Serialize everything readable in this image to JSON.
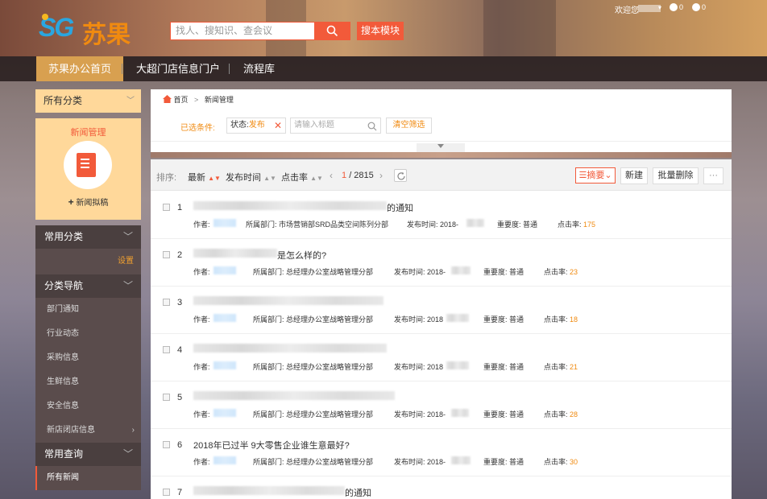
{
  "header": {
    "logo_latin": "SG",
    "logo_cn": "苏果",
    "search_placeholder": "找人、搜知识、查会议",
    "search_module_label": "搜本模块",
    "welcome": "欢迎您",
    "msg_count_1": "0",
    "msg_count_2": "0"
  },
  "nav": {
    "items": [
      "苏果办公首页",
      "大超门店信息门户",
      "流程库"
    ]
  },
  "sidebar": {
    "all_categories": "所有分类",
    "card_title": "新闻管理",
    "card_add": "新闻拟稿",
    "group_common": "常用分类",
    "setting": "设置",
    "group_nav": "分类导航",
    "nav_items": [
      "部门通知",
      "行业动态",
      "采购信息",
      "生鲜信息",
      "安全信息",
      "新店闭店信息"
    ],
    "group_query": "常用查询",
    "all_news": "所有新闻"
  },
  "breadcrumb": {
    "home": "首页",
    "sep": ">",
    "current": "新闻管理"
  },
  "filter": {
    "label": "已选条件:",
    "tag_key": "状态:",
    "tag_value": "发布",
    "title_placeholder": "请输入标题",
    "clear": "清空筛选"
  },
  "toolbar": {
    "sort_label": "排序:",
    "sort_latest": "最新",
    "sort_time": "发布时间",
    "sort_hits": "点击率",
    "page_current": "1",
    "page_total": "/ 2815",
    "summary": "摘要",
    "new": "新建",
    "batch_delete": "批量删除",
    "more": "···"
  },
  "labels": {
    "author": "作者:",
    "dept": "所属部门:",
    "pubtime": "发布时间:",
    "importance": "重要度:",
    "hits": "点击率:"
  },
  "rows": [
    {
      "num": "1",
      "title_suffix": "的通知",
      "dept": "市场营销部SRD品类空间陈列分部",
      "date": "2018-",
      "importance": "普通",
      "hits": "175"
    },
    {
      "num": "2",
      "title_suffix": "是怎么样的?",
      "dept": "总经理办公室战略管理分部",
      "date": "2018-",
      "importance": "普通",
      "hits": "23"
    },
    {
      "num": "3",
      "title_suffix": "",
      "dept": "总经理办公室战略管理分部",
      "date": "2018",
      "importance": "普通",
      "hits": "18"
    },
    {
      "num": "4",
      "title_suffix": "",
      "dept": "总经理办公室战略管理分部",
      "date": "2018",
      "importance": "普通",
      "hits": "21"
    },
    {
      "num": "5",
      "title_suffix": "",
      "dept": "总经理办公室战略管理分部",
      "date": "2018-",
      "importance": "普通",
      "hits": "28"
    },
    {
      "num": "6",
      "title_suffix": "2018年已过半 9大零售企业谁生意最好?",
      "dept": "总经理办公室战略管理分部",
      "date": "2018-",
      "importance": "普通",
      "hits": "30"
    },
    {
      "num": "7",
      "title_suffix": "的通知",
      "dept": "",
      "date": "",
      "importance": "",
      "hits": ""
    }
  ]
}
